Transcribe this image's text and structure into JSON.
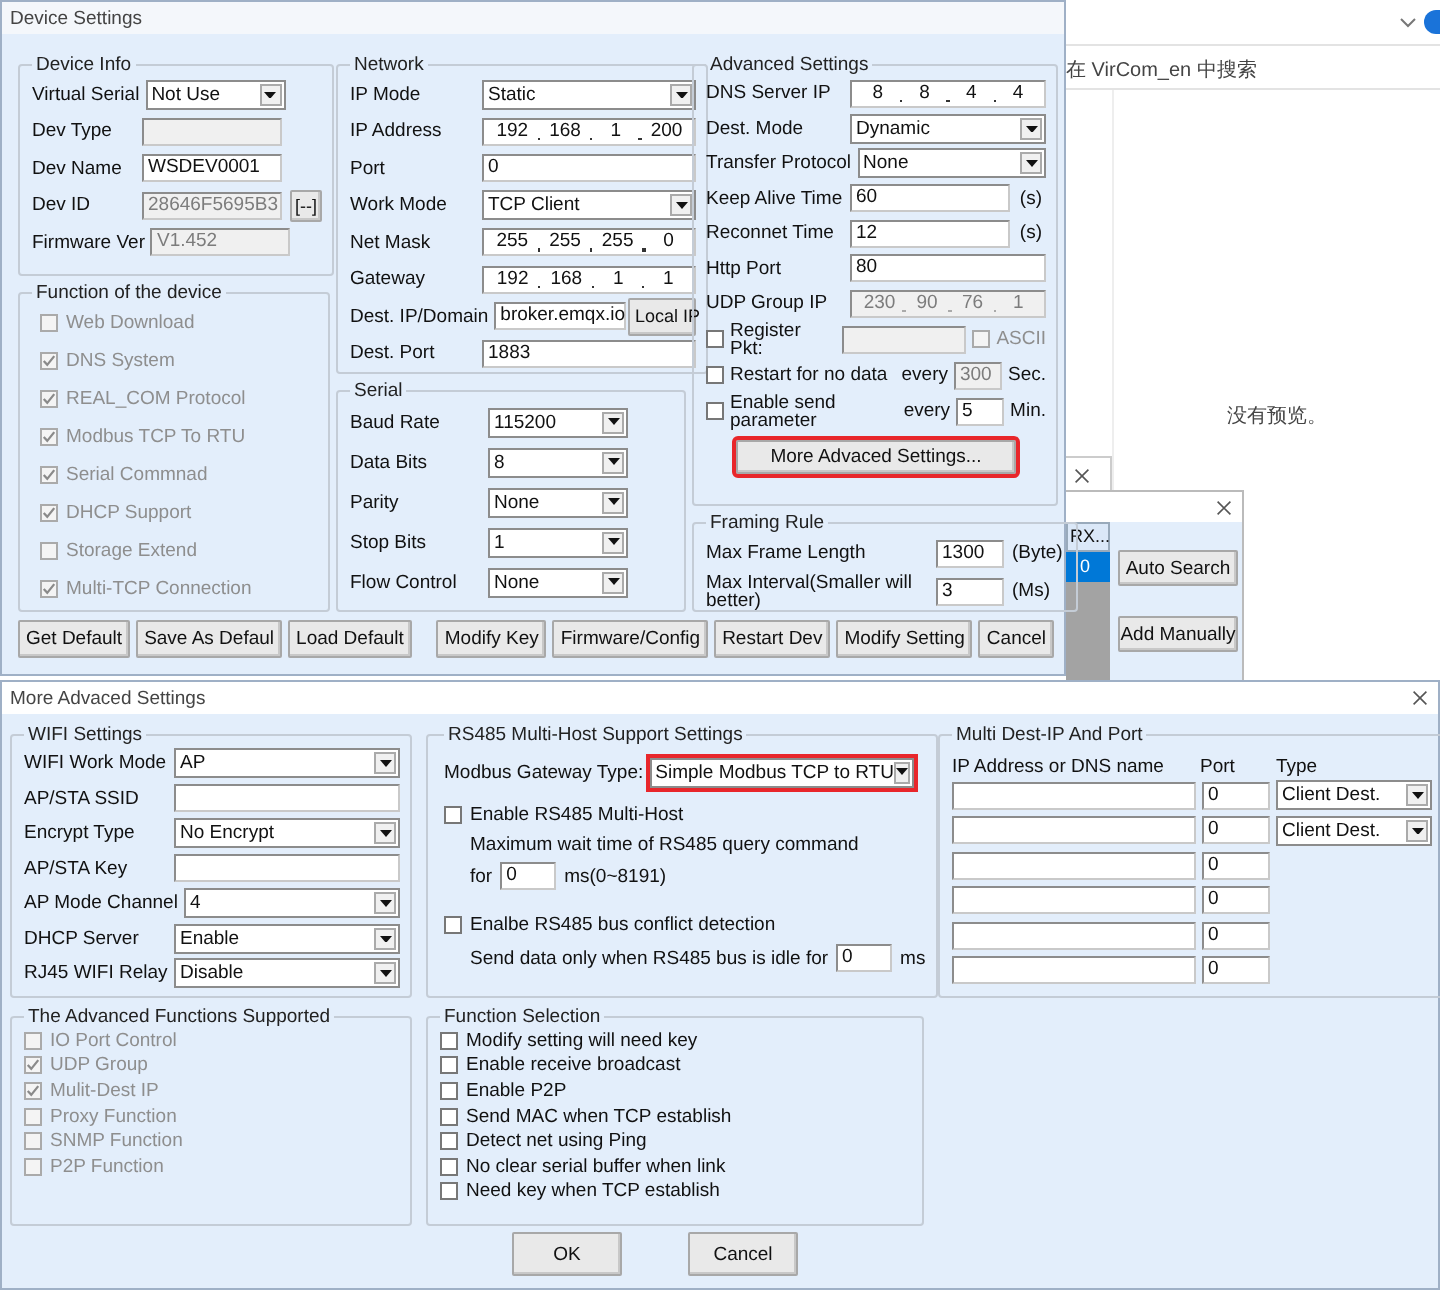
{
  "background": {
    "explorer": {
      "search_placeholder": "在 VirCom_en 中搜索",
      "preview_text": "没有预览。"
    },
    "search_window": {
      "list_header": "RX...",
      "list_rows": [
        {
          "text": "0",
          "selected": true
        }
      ],
      "buttons": [
        "Auto Search",
        "Add Manually"
      ]
    }
  },
  "device_settings": {
    "title": "Device Settings",
    "device_info": {
      "title": "Device Info",
      "fields": [
        {
          "kind": "select",
          "label": "Virtual Serial",
          "value": "Not Use",
          "disabled": false
        },
        {
          "kind": "text",
          "label": "Dev Type",
          "disabled": true
        },
        {
          "kind": "text",
          "label": "Dev Name",
          "value": "WSDEV0001",
          "disabled": false
        },
        {
          "kind": "text",
          "label": "Dev ID",
          "value": "28646F5695B3",
          "disabled": true,
          "button": "[--]"
        },
        {
          "kind": "text",
          "label": "Firmware Ver",
          "value": "V1.452",
          "disabled": true
        }
      ]
    },
    "functions": {
      "title": "Function of the device",
      "items": [
        {
          "label": "Web Download",
          "checked": false,
          "disabled": true
        },
        {
          "label": "DNS System",
          "checked": true,
          "disabled": true
        },
        {
          "label": "REAL_COM Protocol",
          "checked": true,
          "disabled": true
        },
        {
          "label": "Modbus TCP To RTU",
          "checked": true,
          "disabled": true
        },
        {
          "label": "Serial Commnad",
          "checked": true,
          "disabled": true
        },
        {
          "label": "DHCP Support",
          "checked": true,
          "disabled": true
        },
        {
          "label": "Storage Extend",
          "checked": false,
          "disabled": true
        },
        {
          "label": "Multi-TCP Connection",
          "checked": true,
          "disabled": true
        }
      ]
    },
    "network": {
      "title": "Network",
      "fields": [
        {
          "kind": "select",
          "label": "IP Mode",
          "value": "Static",
          "disabled": false
        },
        {
          "kind": "ip",
          "label": "IP Address",
          "value": [
            "192",
            "168",
            "1",
            "200"
          ],
          "disabled": false
        },
        {
          "kind": "text",
          "label": "Port",
          "value": "0",
          "disabled": false
        },
        {
          "kind": "select",
          "label": "Work Mode",
          "value": "TCP Client",
          "disabled": false
        },
        {
          "kind": "ip",
          "label": "Net Mask",
          "value": [
            "255",
            "255",
            "255",
            "0"
          ],
          "disabled": false
        },
        {
          "kind": "ip",
          "label": "Gateway",
          "value": [
            "192",
            "168",
            "1",
            "1"
          ],
          "disabled": false
        },
        {
          "kind": "text",
          "label": "Dest. IP/Domain",
          "value": "broker.emqx.io",
          "disabled": false,
          "button": "Local IP"
        },
        {
          "kind": "text",
          "label": "Dest. Port",
          "value": "1883",
          "disabled": false
        }
      ]
    },
    "serial": {
      "title": "Serial",
      "fields": [
        {
          "kind": "select",
          "label": "Baud Rate",
          "value": "115200",
          "disabled": false
        },
        {
          "kind": "select",
          "label": "Data Bits",
          "value": "8",
          "disabled": false
        },
        {
          "kind": "select",
          "label": "Parity",
          "value": "None",
          "disabled": false
        },
        {
          "kind": "select",
          "label": "Stop Bits",
          "value": "1",
          "disabled": false
        },
        {
          "kind": "select",
          "label": "Flow Control",
          "value": "None",
          "disabled": false
        }
      ]
    },
    "advanced": {
      "title": "Advanced Settings",
      "fields": [
        {
          "kind": "ip",
          "label": "DNS Server IP",
          "value": [
            "8",
            "8",
            "4",
            "4"
          ],
          "disabled": false
        },
        {
          "kind": "select",
          "label": "Dest. Mode",
          "value": "Dynamic",
          "disabled": false
        },
        {
          "kind": "select",
          "label": "Transfer Protocol",
          "value": "None",
          "disabled": false
        },
        {
          "kind": "text",
          "label": "Keep Alive Time",
          "value": "60",
          "disabled": false,
          "unit": "(s)"
        },
        {
          "kind": "text",
          "label": "Reconnet Time",
          "value": "12",
          "disabled": false,
          "unit": "(s)"
        },
        {
          "kind": "text",
          "label": "Http Port",
          "value": "80",
          "disabled": false
        },
        {
          "kind": "ip",
          "label": "UDP Group IP",
          "value": [
            "230",
            "90",
            "76",
            "1"
          ],
          "disabled": true
        }
      ],
      "options": [
        {
          "label": "Register Pkt:",
          "checked": false,
          "field_disabled": true,
          "extra_label": "ASCII",
          "extra_checked": false
        },
        {
          "label": "Restart for no data",
          "checked": false,
          "every": "every",
          "value": "300",
          "field_disabled": true,
          "unit": "Sec."
        },
        {
          "label": "Enable send parameter",
          "checked": false,
          "every": "every",
          "value": "5",
          "field_disabled": false,
          "unit": "Min."
        }
      ],
      "button": {
        "label": "More Advaced Settings...",
        "highlighted": true
      }
    },
    "framing": {
      "title": "Framing Rule",
      "fields": [
        {
          "label": "Max Frame Length",
          "value": "1300",
          "unit": "(Byte)"
        },
        {
          "label": "Max Interval(Smaller will better)",
          "value": "3",
          "unit": "(Ms)"
        }
      ]
    },
    "buttons_left": [
      "Get Default",
      "Save As Defaul",
      "Load Default"
    ],
    "buttons_right": [
      "Modify Key",
      "Firmware/Config",
      "Restart Dev",
      "Modify Setting",
      "Cancel"
    ]
  },
  "more_advanced_settings": {
    "title": "More Advaced Settings",
    "wifi": {
      "title": "WIFI Settings",
      "fields": [
        {
          "kind": "select",
          "label": "WIFI Work Mode",
          "value": "AP",
          "disabled": false
        },
        {
          "kind": "text",
          "label": "AP/STA SSID",
          "disabled": false
        },
        {
          "kind": "select",
          "label": "Encrypt Type",
          "value": "No Encrypt",
          "disabled": false
        },
        {
          "kind": "text",
          "label": "AP/STA Key",
          "disabled": false
        },
        {
          "kind": "select",
          "label": "AP Mode Channel",
          "value": "4",
          "disabled": false
        },
        {
          "kind": "select",
          "label": "DHCP Server",
          "value": "Enable",
          "disabled": false
        },
        {
          "kind": "select",
          "label": "RJ45 WIFI Relay",
          "value": "Disable",
          "disabled": false
        }
      ]
    },
    "rs485": {
      "title": "RS485 Multi-Host Support Settings",
      "gateway": {
        "kind": "select",
        "label": "Modbus Gateway Type:",
        "value": "Simple Modbus TCP to RTU",
        "disabled": false,
        "highlighted": true
      },
      "multi_host": {
        "label": "Enable RS485 Multi-Host",
        "checked": false,
        "note": "Maximum wait time of RS485  query command",
        "prefix": "for",
        "value": "0",
        "unit": "ms(0~8191)"
      },
      "conflict": {
        "label": "Enalbe RS485 bus conflict detection",
        "checked": false,
        "note": "Send data only when RS485 bus is idle for",
        "value": "0",
        "unit": "ms"
      }
    },
    "advanced_functions": {
      "title": "The Advanced Functions Supported",
      "items": [
        {
          "label": "IO Port Control",
          "checked": false,
          "disabled": true
        },
        {
          "label": "UDP Group",
          "checked": true,
          "disabled": true
        },
        {
          "label": "Mulit-Dest IP",
          "checked": true,
          "disabled": true
        },
        {
          "label": "Proxy Function",
          "checked": false,
          "disabled": true
        },
        {
          "label": "SNMP Function",
          "checked": false,
          "disabled": true
        },
        {
          "label": "P2P Function",
          "checked": false,
          "disabled": true
        }
      ]
    },
    "function_selection": {
      "title": "Function Selection",
      "items": [
        {
          "label": "Modify setting will need key",
          "checked": false,
          "disabled": false
        },
        {
          "label": "Enable receive broadcast",
          "checked": false,
          "disabled": false
        },
        {
          "label": "Enable P2P",
          "checked": false,
          "disabled": false
        },
        {
          "label": "Send MAC when TCP establish",
          "checked": false,
          "disabled": false
        },
        {
          "label": "Detect net using Ping",
          "checked": false,
          "disabled": false
        },
        {
          "label": "No clear serial buffer when link",
          "checked": false,
          "disabled": false
        },
        {
          "label": "Need key when TCP establish",
          "checked": false,
          "disabled": false
        }
      ]
    },
    "multi_dest": {
      "title": "Multi Dest-IP And Port",
      "columns": [
        "IP Address or DNS name",
        "Port",
        "Type"
      ],
      "rows": [
        {
          "port": "0",
          "type": "Client Dest."
        },
        {
          "port": "0",
          "type": "Client Dest."
        },
        {
          "port": "0"
        },
        {
          "port": "0"
        },
        {
          "port": "0"
        },
        {
          "port": "0"
        }
      ]
    },
    "buttons": [
      "OK",
      "Cancel"
    ]
  }
}
